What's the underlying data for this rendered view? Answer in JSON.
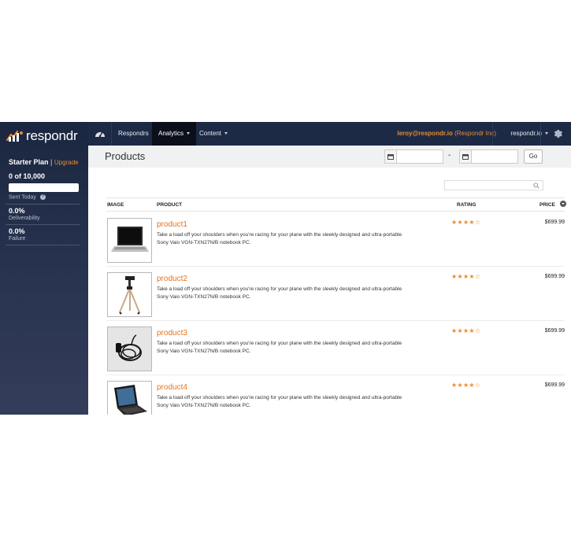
{
  "app": {
    "logo_text": "respondr"
  },
  "sidebar": {
    "plan_name": "Starter Plan",
    "plan_sep": "|",
    "upgrade_label": "Upgrade",
    "sent_count": "0 of 10,000",
    "sent_fraction": 0,
    "sent_label": "Sent Today",
    "deliverability_value": "0.0%",
    "deliverability_label": "Deliverability",
    "failure_value": "0.0%",
    "failure_label": "Failure"
  },
  "nav": {
    "items": [
      {
        "label": "Respondrs"
      },
      {
        "label": "Analytics"
      },
      {
        "label": "Content"
      }
    ],
    "email": "leroy@respondr.io",
    "org": "(Respondr Inc)",
    "account": "respondr.io"
  },
  "header": {
    "title": "Products",
    "start_date": "",
    "end_date": "",
    "dash": "-",
    "go_label": "Go"
  },
  "search": {
    "value": ""
  },
  "table": {
    "columns": [
      "IMAGE",
      "PRODUCT",
      "RATING",
      "PRICE"
    ],
    "rows": [
      {
        "name": "product1",
        "image": "laptop-icon",
        "description": "Take a load off your shoulders when you're racing for your plane with the sleekly designed and ultra-portable Sony Vaio VGN-TXN27N/B notebook PC.",
        "rating": "★★★★☆",
        "price": "$699.99"
      },
      {
        "name": "product2",
        "image": "tripod-icon",
        "description": "Take a load off your shoulders when you're racing for your plane with the sleekly designed and ultra-portable Sony Vaio VGN-TXN27N/B notebook PC.",
        "rating": "★★★★☆",
        "price": "$699.99"
      },
      {
        "name": "product3",
        "image": "cable-icon",
        "description": "Take a load off your shoulders when you're racing for your plane with the sleekly designed and ultra-portable Sony Vaio VGN-TXN27N/B notebook PC.",
        "rating": "★★★★☆",
        "price": "$699.99"
      },
      {
        "name": "product4",
        "image": "laptop-open-icon",
        "description": "Take a load off your shoulders when you're racing for your plane with the sleekly designed and ultra-portable Sony Vaio VGN-TXN27N/B notebook PC.",
        "rating": "★★★★☆",
        "price": "$699.99"
      }
    ]
  },
  "colors": {
    "accent": "#e98b2d",
    "nav_bg": "#1d2a45",
    "sidebar_bg": "#2a3552"
  }
}
